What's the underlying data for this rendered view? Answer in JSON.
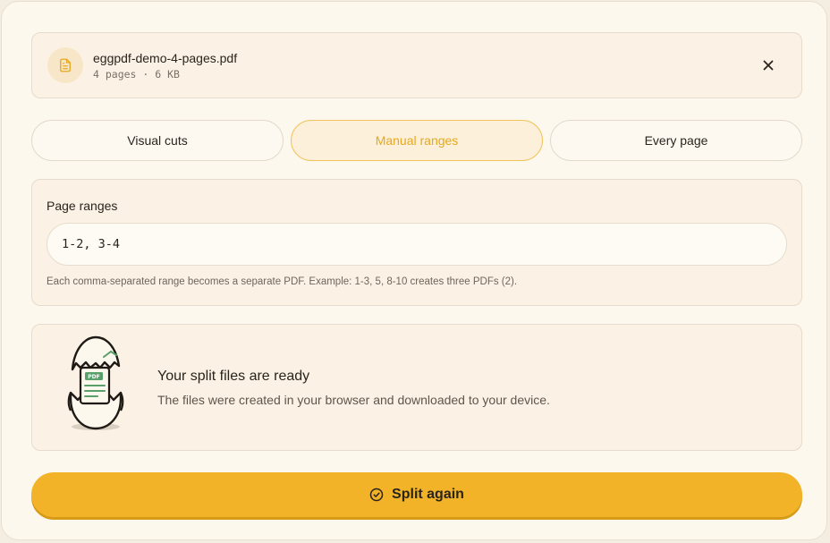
{
  "file": {
    "name": "eggpdf-demo-4-pages.pdf",
    "meta": "4 pages · 6 KB"
  },
  "tabs": [
    {
      "label": "Visual cuts",
      "active": false
    },
    {
      "label": "Manual ranges",
      "active": true
    },
    {
      "label": "Every page",
      "active": false
    }
  ],
  "ranges": {
    "label": "Page ranges",
    "value": "1-2, 3-4",
    "help": "Each comma-separated range becomes a separate PDF. Example: 1-3, 5, 8-10 creates three PDFs (2)."
  },
  "result": {
    "title": "Your split files are ready",
    "subtitle": "The files were created in your browser and downloaded to your device.",
    "illustration_badge": "PDF"
  },
  "action": {
    "label": "Split again"
  },
  "colors": {
    "accent": "#f2b329",
    "accent_text": "#e5a820",
    "card_bg": "#fdf8ee",
    "panel_bg": "#fbf1e4"
  },
  "icons": {
    "file": "document-icon",
    "close": "close-icon",
    "action": "check-circle-icon",
    "illustration": "egg-pdf-illustration"
  }
}
